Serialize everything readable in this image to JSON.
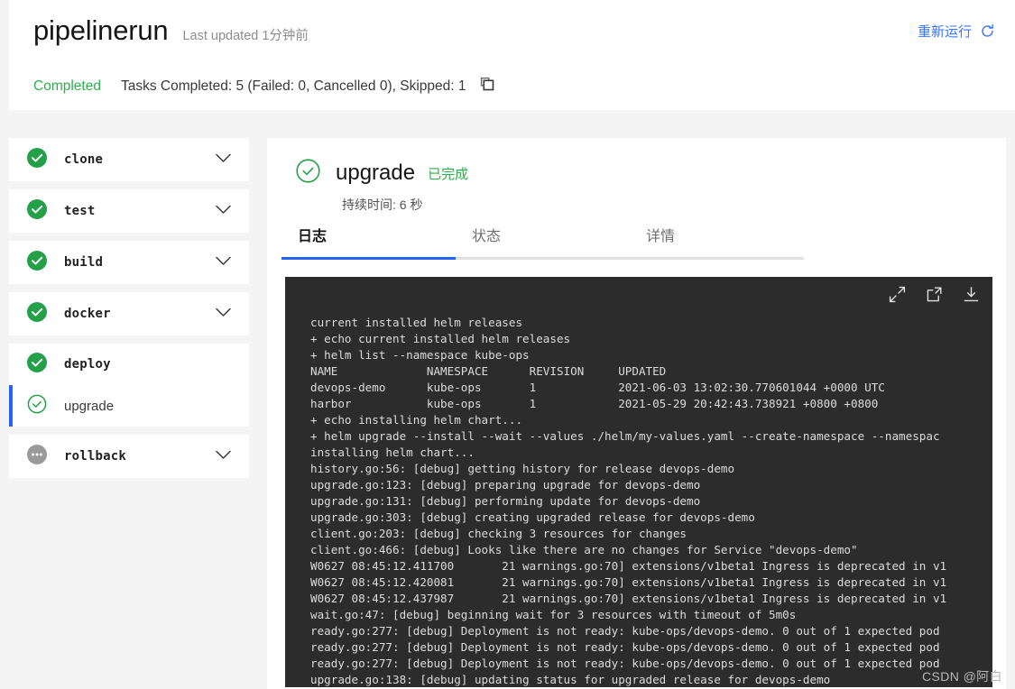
{
  "header": {
    "title": "pipelinerun",
    "last_updated": "Last updated 1分钟前",
    "rerun_label": "重新运行",
    "rerun_icon": "refresh-icon",
    "status": "Completed",
    "tasks_summary": "Tasks Completed: 5 (Failed: 0, Cancelled 0), Skipped: 1",
    "copy_icon": "copy-icon",
    "accent_blue": "#3b74ff",
    "success_green": "#2eae4e"
  },
  "sidebar": {
    "tasks": [
      {
        "name": "clone",
        "status": "succeeded",
        "icon": "check-filled-icon",
        "chevron": "chevron-down-icon"
      },
      {
        "name": "test",
        "status": "succeeded",
        "icon": "check-filled-icon",
        "chevron": "chevron-down-icon"
      },
      {
        "name": "build",
        "status": "succeeded",
        "icon": "check-filled-icon",
        "chevron": "chevron-down-icon"
      },
      {
        "name": "docker",
        "status": "succeeded",
        "icon": "check-filled-icon",
        "chevron": "chevron-down-icon"
      },
      {
        "name": "deploy",
        "status": "succeeded",
        "icon": "check-filled-icon",
        "expanded": true,
        "steps": [
          {
            "name": "upgrade",
            "status": "completed",
            "icon": "check-outline-icon",
            "selected": true
          }
        ]
      },
      {
        "name": "rollback",
        "status": "pending",
        "icon": "pending-dots-icon",
        "chevron": "chevron-down-icon"
      }
    ]
  },
  "main": {
    "step": {
      "icon": "check-outline-icon",
      "name": "upgrade",
      "state": "已完成",
      "duration": "持续时间: 6 秒"
    },
    "tabs": [
      {
        "label": "日志",
        "active": true
      },
      {
        "label": "状态",
        "active": false
      },
      {
        "label": "详情",
        "active": false
      }
    ],
    "terminal": {
      "toolbar_icons": [
        "expand-icon",
        "external-link-icon",
        "download-icon"
      ],
      "lines": [
        "current installed helm releases",
        "+ echo current installed helm releases",
        "+ helm list --namespace kube-ops",
        "NAME             NAMESPACE      REVISION     UPDATED",
        "devops-demo      kube-ops       1            2021-06-03 13:02:30.770601044 +0000 UTC",
        "harbor           kube-ops       1            2021-05-29 20:42:43.738921 +0800 +0800",
        "+ echo installing helm chart...",
        "+ helm upgrade --install --wait --values ./helm/my-values.yaml --create-namespace --namespac",
        "installing helm chart...",
        "history.go:56: [debug] getting history for release devops-demo",
        "upgrade.go:123: [debug] preparing upgrade for devops-demo",
        "upgrade.go:131: [debug] performing update for devops-demo",
        "upgrade.go:303: [debug] creating upgraded release for devops-demo",
        "client.go:203: [debug] checking 3 resources for changes",
        "client.go:466: [debug] Looks like there are no changes for Service \"devops-demo\"",
        "W0627 08:45:12.411700       21 warnings.go:70] extensions/v1beta1 Ingress is deprecated in v1",
        "W0627 08:45:12.420081       21 warnings.go:70] extensions/v1beta1 Ingress is deprecated in v1",
        "W0627 08:45:12.437987       21 warnings.go:70] extensions/v1beta1 Ingress is deprecated in v1",
        "wait.go:47: [debug] beginning wait for 3 resources with timeout of 5m0s",
        "ready.go:277: [debug] Deployment is not ready: kube-ops/devops-demo. 0 out of 1 expected pod",
        "ready.go:277: [debug] Deployment is not ready: kube-ops/devops-demo. 0 out of 1 expected pod",
        "ready.go:277: [debug] Deployment is not ready: kube-ops/devops-demo. 0 out of 1 expected pod",
        "upgrade.go:138: [debug] updating status for upgraded release for devops-demo"
      ]
    }
  },
  "watermark": "CSDN @阿白"
}
